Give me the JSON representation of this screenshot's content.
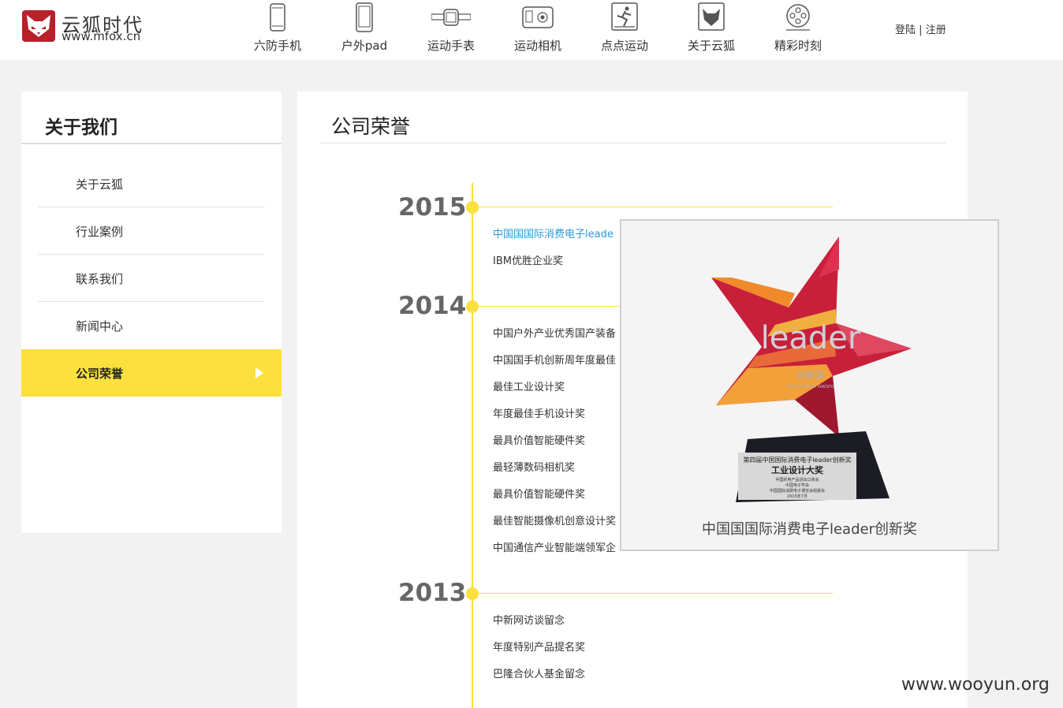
{
  "brand": {
    "name_cn": "云狐时代",
    "url": "www.mfox.cn",
    "color": "#b8202a"
  },
  "nav": [
    {
      "label": "六防手机",
      "icon": "phone-icon"
    },
    {
      "label": "户外pad",
      "icon": "tablet-icon"
    },
    {
      "label": "运动手表",
      "icon": "watch-icon"
    },
    {
      "label": "运动相机",
      "icon": "camera-icon"
    },
    {
      "label": "点点运动",
      "icon": "running-icon"
    },
    {
      "label": "关于云狐",
      "icon": "fox-icon"
    },
    {
      "label": "精彩时刻",
      "icon": "film-reel-icon"
    }
  ],
  "auth": {
    "login": "登陆",
    "divider": "|",
    "register": "注册"
  },
  "sidebar": {
    "title": "关于我们",
    "items": [
      {
        "label": "关于云狐"
      },
      {
        "label": "行业案例"
      },
      {
        "label": "联系我们"
      },
      {
        "label": "新闻中心"
      },
      {
        "label": "公司荣誉",
        "active": true
      }
    ],
    "accent": "#fbe03e"
  },
  "main": {
    "title": "公司荣誉"
  },
  "timeline": [
    {
      "year": "2015",
      "awards": [
        "中国国国际消费电子leade",
        "IBM优胜企业奖"
      ]
    },
    {
      "year": "2014",
      "awards": [
        "中国户外产业优秀国产装备",
        "中国国手机创新周年度最佳",
        "最佳工业设计奖",
        "年度最佳手机设计奖",
        "最具价值智能硬件奖",
        "最轻薄数码相机奖",
        "最具价值智能硬件奖",
        "最佳智能摄像机创意设计奖",
        "中国通信产业智能端领军企"
      ]
    },
    {
      "year": "2013",
      "awards": [
        "中新网访谈留念",
        "年度特别产品提名奖",
        "巴隆合伙人基金留念"
      ]
    }
  ],
  "popup": {
    "caption": "中国国国际消费电子leader创新奖",
    "trophy": {
      "logo_text": "leader",
      "sub_cn": "创新奖",
      "sub_en": "Innovation Award",
      "plaque": [
        "第四届中国国际消费电子leader创新奖",
        "工业设计大奖",
        "中国机电产品进出口商会",
        "中国电子学会",
        "中国国际消费电子博览会组委会",
        "2015年7月"
      ]
    }
  },
  "watermark": "www.wooyun.org"
}
